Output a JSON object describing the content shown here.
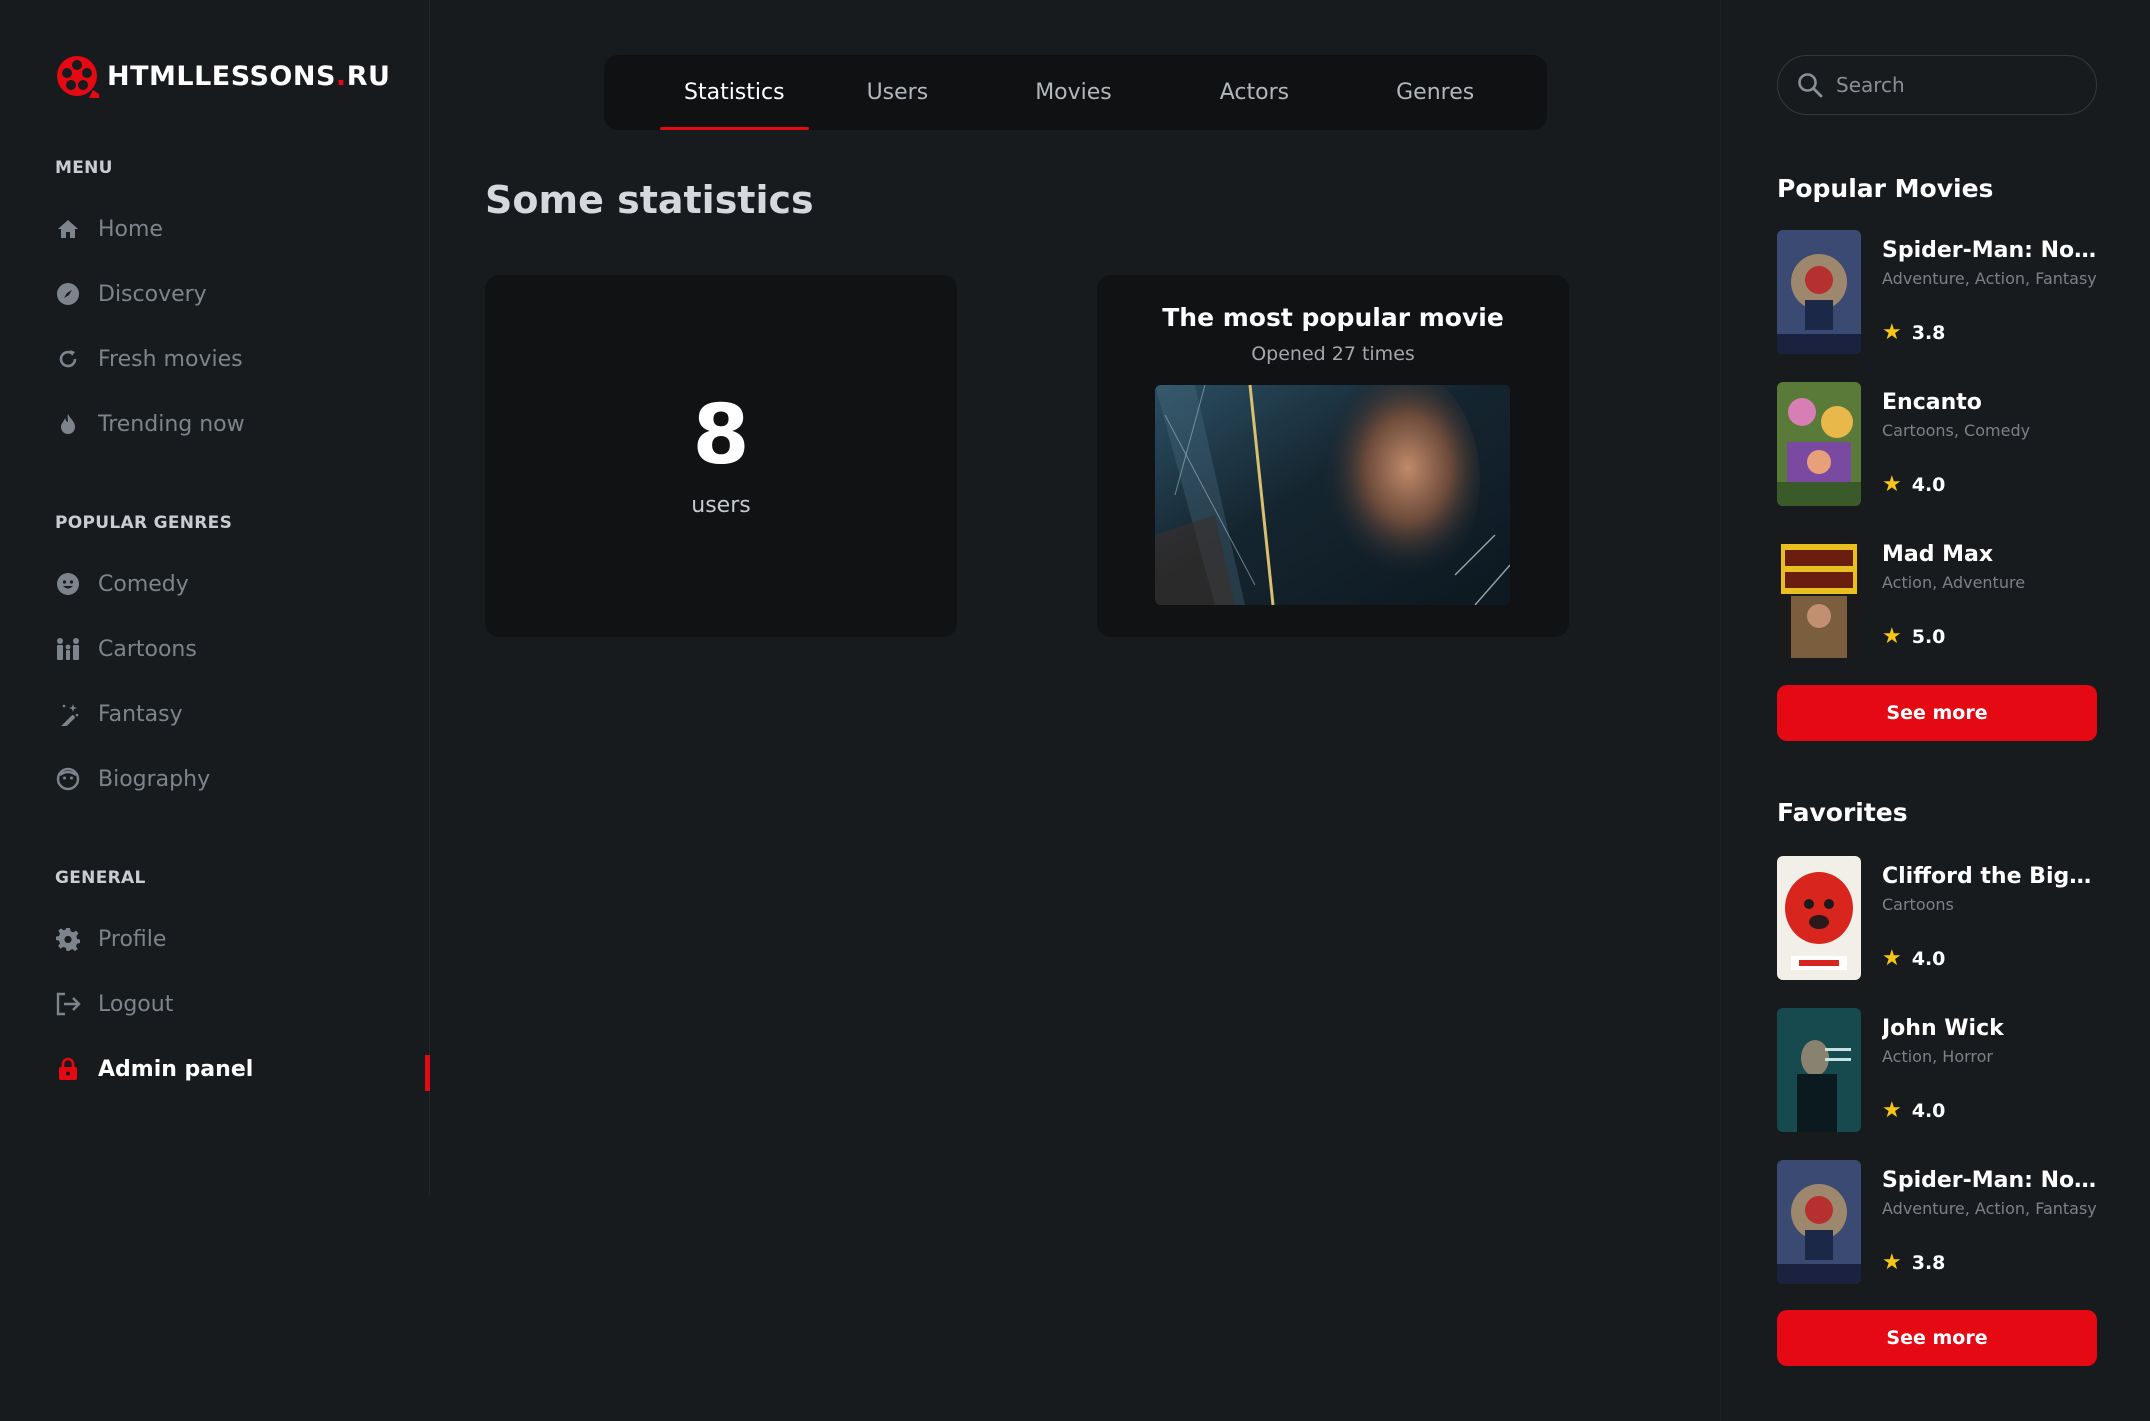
{
  "brand": {
    "name": "HTMLLESSONS",
    "dot": ".",
    "tld": "RU",
    "accent": "#e50914"
  },
  "sidebar": {
    "menu_title": "MENU",
    "menu": [
      {
        "label": "Home",
        "icon": "home-icon"
      },
      {
        "label": "Discovery",
        "icon": "compass-icon"
      },
      {
        "label": "Fresh movies",
        "icon": "refresh-icon"
      },
      {
        "label": "Trending now",
        "icon": "fire-icon"
      }
    ],
    "genres_title": "POPULAR GENRES",
    "genres": [
      {
        "label": "Comedy",
        "icon": "smile-icon"
      },
      {
        "label": "Cartoons",
        "icon": "family-icon"
      },
      {
        "label": "Fantasy",
        "icon": "magic-wand-icon"
      },
      {
        "label": "Biography",
        "icon": "face-icon"
      }
    ],
    "general_title": "GENERAL",
    "general": [
      {
        "label": "Profile",
        "icon": "gear-icon"
      },
      {
        "label": "Logout",
        "icon": "logout-icon"
      },
      {
        "label": "Admin panel",
        "icon": "lock-icon",
        "active": true
      }
    ]
  },
  "tabs": [
    "Statistics",
    "Users",
    "Movies",
    "Actors",
    "Genres"
  ],
  "selected_tab": "Statistics",
  "main": {
    "title": "Some statistics",
    "users_card": {
      "count": "8",
      "label": "users"
    },
    "movie_card": {
      "title": "The most popular movie",
      "subtitle": "Opened 27 times"
    }
  },
  "right": {
    "search_placeholder": "Search",
    "popular_title": "Popular Movies",
    "popular": [
      {
        "name": "Spider-Man: No W...",
        "genres": "Adventure, Action, Fantasy",
        "rating": "3.8"
      },
      {
        "name": "Encanto",
        "genres": "Cartoons, Comedy",
        "rating": "4.0"
      },
      {
        "name": "Mad Max",
        "genres": "Action, Adventure",
        "rating": "5.0"
      }
    ],
    "see_more": "See more",
    "favorites_title": "Favorites",
    "favorites": [
      {
        "name": "Clifford the Big Red...",
        "genres": "Cartoons",
        "rating": "4.0"
      },
      {
        "name": "John Wick",
        "genres": "Action, Horror",
        "rating": "4.0"
      },
      {
        "name": "Spider-Man: No W...",
        "genres": "Adventure, Action, Fantasy",
        "rating": "3.8"
      }
    ],
    "see_more_2": "See more"
  }
}
